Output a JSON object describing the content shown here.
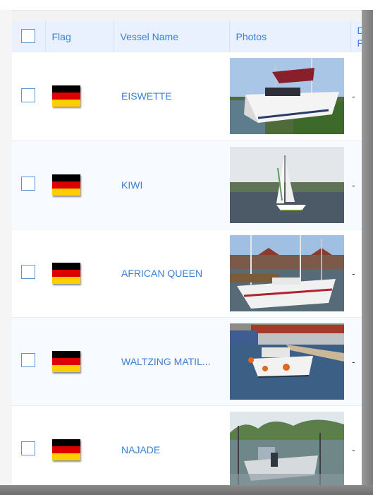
{
  "table": {
    "headers": {
      "flag": "Flag",
      "vessel_name": "Vessel Name",
      "photos": "Photos",
      "destination_port": "Dest Port"
    },
    "rows": [
      {
        "flag": "Germany",
        "vessel_name": "EISWETTE",
        "destination": "-"
      },
      {
        "flag": "Germany",
        "vessel_name": "KIWI",
        "destination": "-"
      },
      {
        "flag": "Germany",
        "vessel_name": "AFRICAN QUEEN",
        "destination": "-"
      },
      {
        "flag": "Germany",
        "vessel_name": "WALTZING MATIL...",
        "destination": "-"
      },
      {
        "flag": "Germany",
        "vessel_name": "NAJADE",
        "destination": "-"
      }
    ]
  },
  "colors": {
    "link": "#3d7fd1",
    "header_bg": "#e8f1fd",
    "checkbox_border": "#5b95d9",
    "flag_black": "#000000",
    "flag_red": "#dd0000",
    "flag_gold": "#ffce00"
  }
}
